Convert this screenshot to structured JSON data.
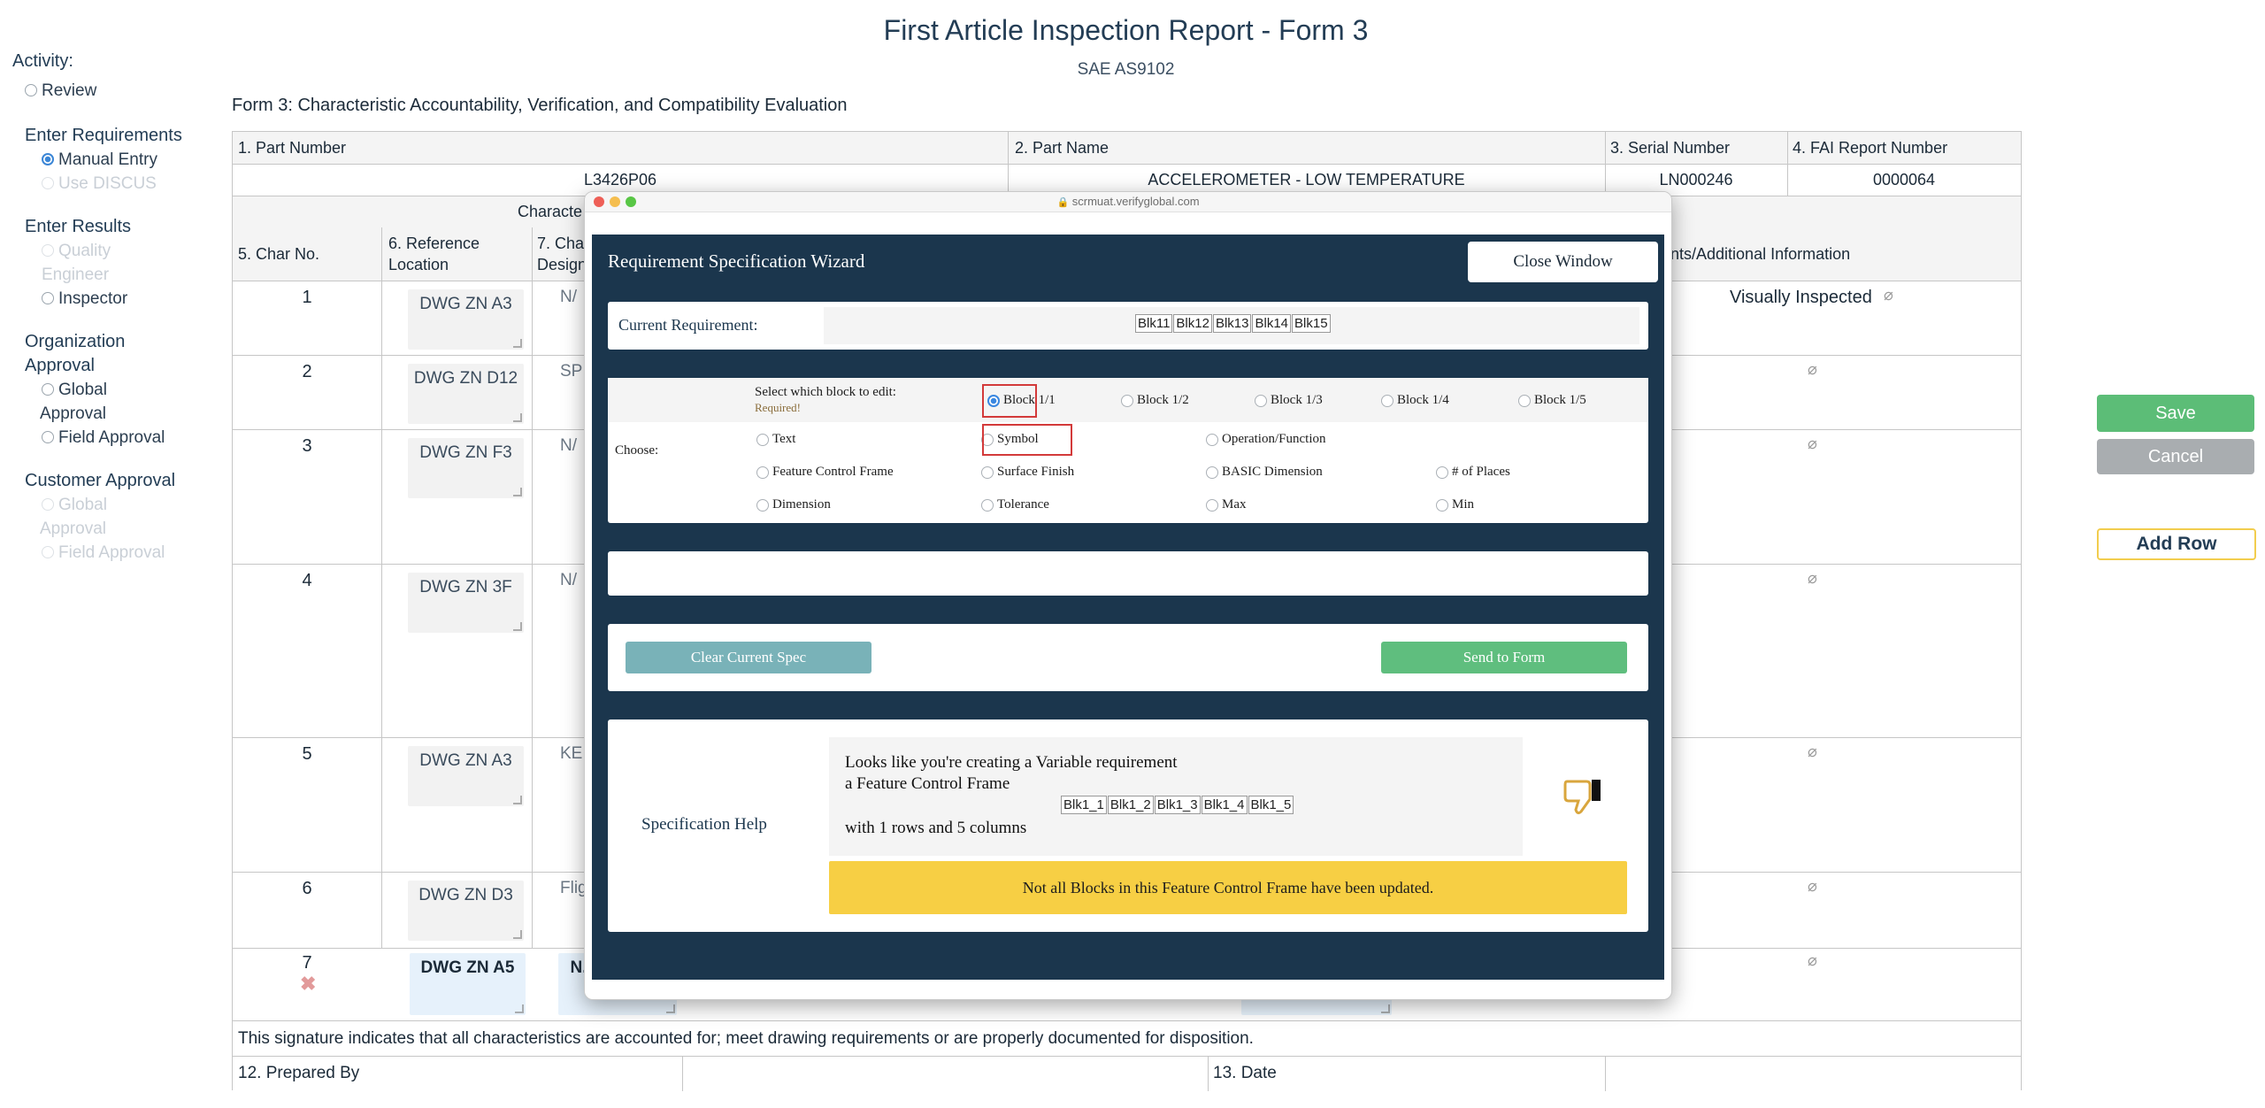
{
  "header": {
    "title": "First Article Inspection Report - Form 3",
    "subtitle": "SAE AS9102",
    "form_title": "Form 3: Characteristic Accountability, Verification, and Compatibility Evaluation"
  },
  "sidebar": {
    "activity_label": "Activity:",
    "review": "Review",
    "enter_requirements": "Enter Requirements",
    "manual_entry": "Manual Entry",
    "use_discus": "Use DISCUS",
    "enter_results": "Enter Results",
    "quality_engineer_1": "Quality",
    "quality_engineer_2": "Engineer",
    "inspector": "Inspector",
    "org_approval_1": "Organization",
    "org_approval_2": "Approval",
    "org_global_1": "Global",
    "org_global_2": "Approval",
    "org_field": "Field Approval",
    "customer_approval": "Customer Approval",
    "cust_global_1": "Global",
    "cust_global_2": "Approval",
    "cust_field": "Field Approval"
  },
  "actions": {
    "save": "Save",
    "cancel": "Cancel",
    "add_row": "Add Row"
  },
  "table": {
    "h_part_number": "1. Part Number",
    "h_part_name": "2. Part Name",
    "h_serial": "3. Serial Number",
    "h_fai": "4. FAI Report Number",
    "part_number": "L3426P06",
    "part_name": "ACCELEROMETER - LOW TEMPERATURE",
    "serial": "LN000246",
    "fai": "0000064",
    "char_group": "Characte",
    "h_char_no": "5. Char No.",
    "h_ref_1": "6. Reference",
    "h_ref_2": "Location",
    "h_desig_1": "7. Cha",
    "h_desig_2": "Design",
    "h_comments": "ments/Additional Information",
    "rows": [
      {
        "no": "1",
        "ref": "DWG ZN A3",
        "desig": "N/",
        "comment": "Visually Inspected"
      },
      {
        "no": "2",
        "ref": "DWG ZN D12",
        "desig": "SP",
        "comment": ""
      },
      {
        "no": "3",
        "ref": "DWG ZN F3",
        "desig": "N/",
        "comment": ""
      },
      {
        "no": "4",
        "ref": "DWG ZN 3F",
        "desig": "N/",
        "comment": ""
      },
      {
        "no": "5",
        "ref": "DWG ZN A3",
        "desig": "KE",
        "comment": ""
      },
      {
        "no": "6",
        "ref": "DWG ZN D3",
        "desig": "Flig",
        "comment": ""
      },
      {
        "no": "7",
        "ref": "DWG ZN A5",
        "desig": "N.",
        "comment": ""
      }
    ],
    "signature_note": "This signature indicates that all characteristics are accounted for; meet drawing requirements or are properly documented for disposition.",
    "prepared_by": "12. Prepared By",
    "date": "13. Date"
  },
  "popup": {
    "url": "scrmuat.verifyglobal.com",
    "wizard_title": "Requirement Specification Wizard",
    "close": "Close Window",
    "current_req_label": "Current Requirement:",
    "current_tokens": [
      "Blk11",
      "Blk12",
      "Blk13",
      "Blk14",
      "Blk15"
    ],
    "select_block_label": "Select which block to edit:",
    "required": "Required!",
    "blocks": [
      "Block 1/1",
      "Block 1/2",
      "Block 1/3",
      "Block 1/4",
      "Block 1/5"
    ],
    "choose_label": "Choose:",
    "choices_row1": [
      "Text",
      "Symbol",
      "Operation/Function"
    ],
    "choices_row2": [
      "Feature Control Frame",
      "Surface Finish",
      "BASIC Dimension",
      "# of Places"
    ],
    "choices_row3": [
      "Dimension",
      "Tolerance",
      "Max",
      "Min"
    ],
    "clear_btn": "Clear Current Spec",
    "send_btn": "Send to Form",
    "help_label": "Specification Help",
    "help_line1": "Looks like you're creating a Variable requirement",
    "help_line2": "a Feature Control Frame",
    "help_line3": "with 1 rows and 5 columns",
    "help_tokens": [
      "Blk1_1",
      "Blk1_2",
      "Blk1_3",
      "Blk1_4",
      "Blk1_5"
    ],
    "warning": "Not all Blocks in this Feature Control Frame have been updated."
  },
  "colors": {
    "navy": "#1b364d",
    "save": "#5cbd77",
    "warning": "#f7cf44",
    "send": "#5fbe7e",
    "clear": "#79b2b8"
  }
}
